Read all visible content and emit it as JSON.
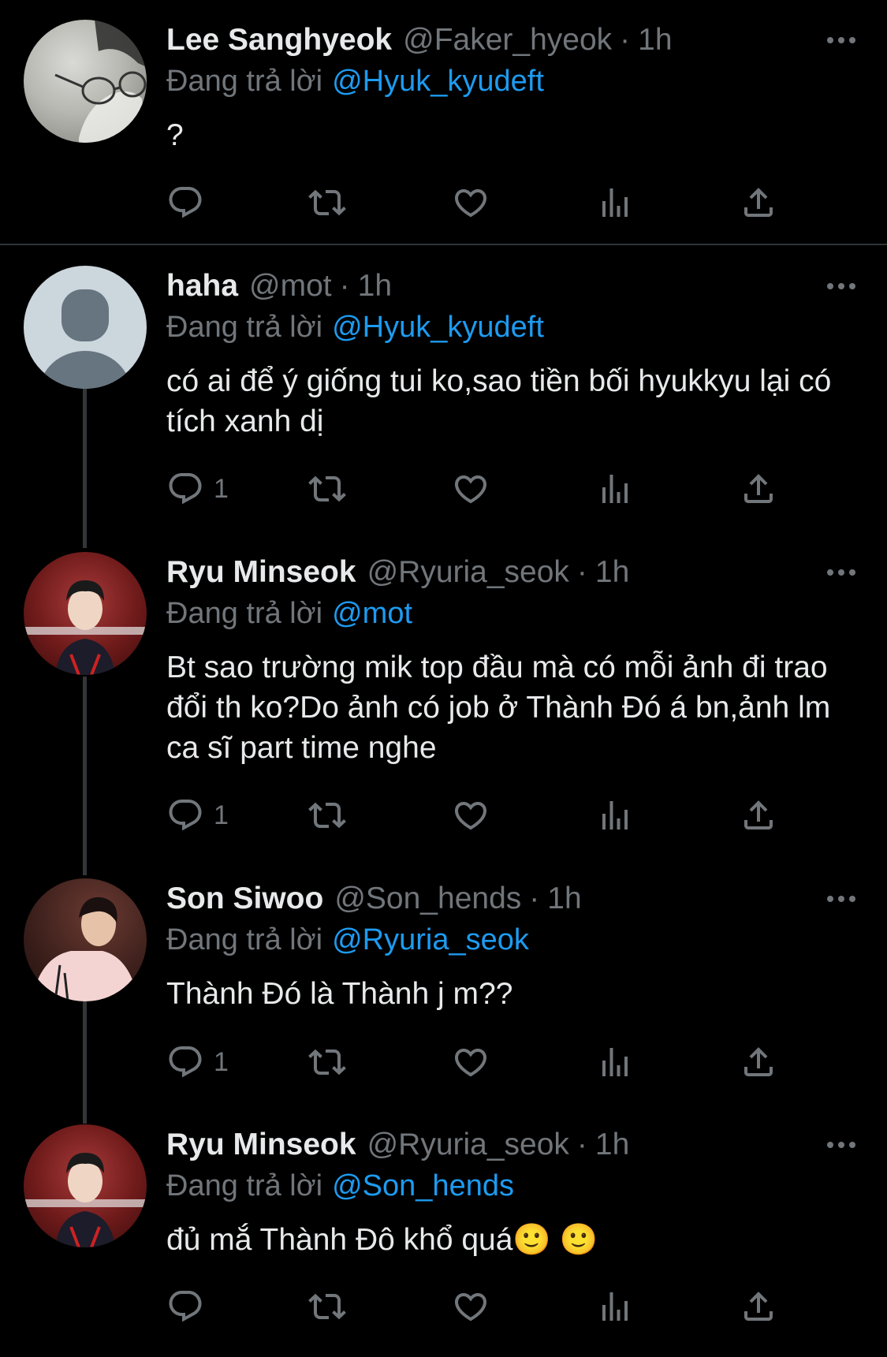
{
  "tweets": [
    {
      "name": "Lee Sanghyeok",
      "handle": "@Faker_hyeok",
      "time": "1h",
      "reply_prefix": "Đang trả lời",
      "reply_to": "@Hyuk_kyudeft",
      "text": "?",
      "reply_count": "",
      "avatar": "faker-photo-avatar"
    },
    {
      "name": "haha",
      "handle": "@mot",
      "time": "1h",
      "reply_prefix": "Đang trả lời",
      "reply_to": "@Hyuk_kyudeft",
      "text": "có ai để ý giống tui ko,sao tiền bối hyukkyu lại có tích xanh dị",
      "reply_count": "1",
      "avatar": "default-avatar"
    },
    {
      "name": "Ryu Minseok",
      "handle": "@Ryuria_seok",
      "time": "1h",
      "reply_prefix": "Đang trả lời",
      "reply_to": "@mot",
      "text": "Bt sao trường mik top đầu mà có mỗi ảnh đi trao đổi th ko?Do ảnh có job ở Thành Đó á bn,ảnh lm ca sĩ part time nghe",
      "reply_count": "1",
      "avatar": "ryu-photo-avatar"
    },
    {
      "name": "Son Siwoo",
      "handle": "@Son_hends",
      "time": "1h",
      "reply_prefix": "Đang trả lời",
      "reply_to": "@Ryuria_seok",
      "text": "Thành Đó là Thành j m??",
      "reply_count": "1",
      "avatar": "son-photo-avatar"
    },
    {
      "name": "Ryu Minseok",
      "handle": "@Ryuria_seok",
      "time": "1h",
      "reply_prefix": "Đang trả lời",
      "reply_to": "@Son_hends",
      "text": "đủ mắ Thành Đô khổ quá🙂 🙂",
      "reply_count": "",
      "avatar": "ryu-photo-avatar"
    }
  ],
  "separator": "·",
  "icons": [
    "reply-icon",
    "retweet-icon",
    "like-icon",
    "views-icon",
    "share-icon",
    "more-icon"
  ],
  "colors": {
    "background": "#000000",
    "text": "#e7e9ea",
    "muted": "#71767b",
    "link": "#1d9bf0",
    "thread_line": "#333639"
  }
}
